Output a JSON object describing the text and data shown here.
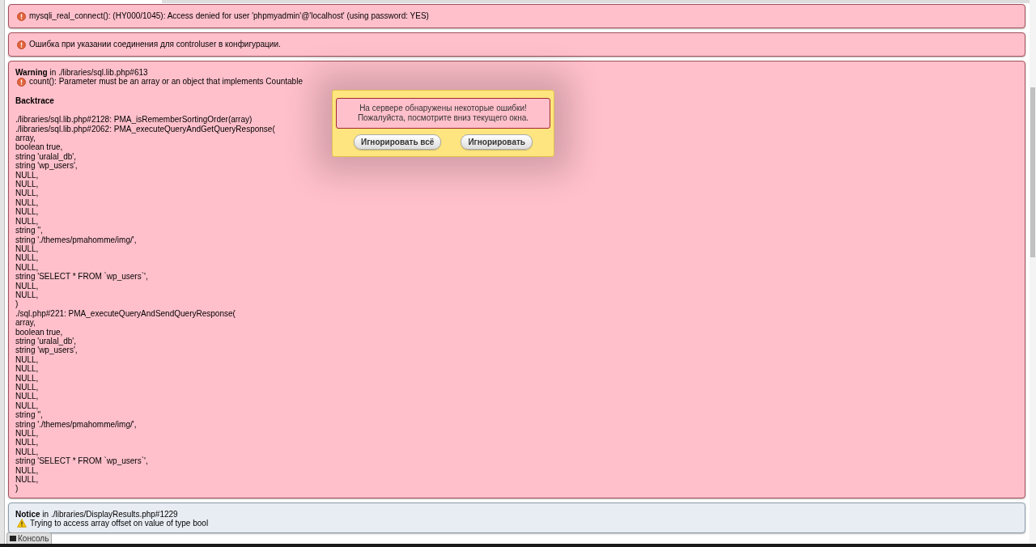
{
  "errors": [
    {
      "kind": "error",
      "message": "mysqli_real_connect(): (HY000/1045): Access denied for user 'phpmyadmin'@'localhost' (using password: YES)"
    },
    {
      "kind": "error",
      "message": "Ошибка при указании соединения для controluser в конфигурации."
    }
  ],
  "reports": [
    {
      "kind": "error",
      "heading": "Warning",
      "location": "in ./libraries/sql.lib.php#613",
      "message": "count(): Parameter must be an array or an object that implements Countable",
      "backtrace_title": "Backtrace",
      "backtrace": [
        "./libraries/sql.lib.php#2128: PMA_isRememberSortingOrder(array)",
        "./libraries/sql.lib.php#2062: PMA_executeQueryAndGetQueryResponse(",
        "array,",
        "boolean true,",
        "string 'uralal_db',",
        "string 'wp_users',",
        "NULL,",
        "NULL,",
        "NULL,",
        "NULL,",
        "NULL,",
        "NULL,",
        "string '',",
        "string './themes/pmahomme/img/',",
        "NULL,",
        "NULL,",
        "NULL,",
        "string 'SELECT * FROM `wp_users`',",
        "NULL,",
        "NULL,",
        ")",
        "./sql.php#221: PMA_executeQueryAndSendQueryResponse(",
        "array,",
        "boolean true,",
        "string 'uralal_db',",
        "string 'wp_users',",
        "NULL,",
        "NULL,",
        "NULL,",
        "NULL,",
        "NULL,",
        "NULL,",
        "string '',",
        "string './themes/pmahomme/img/',",
        "NULL,",
        "NULL,",
        "NULL,",
        "string 'SELECT * FROM `wp_users`',",
        "NULL,",
        "NULL,",
        ")"
      ]
    },
    {
      "kind": "warning",
      "heading": "Notice",
      "location": "in ./libraries/DisplayResults.php#1229",
      "message": "Trying to access array offset on value of type bool"
    }
  ],
  "dialog": {
    "message_lines": [
      "На сервере обнаружены некоторые ошибки!",
      "Пожалуйста, посмотрите вниз текущего окна."
    ],
    "buttons": [
      "Игнорировать всё",
      "Игнорировать"
    ]
  },
  "console_tab": {
    "label": "Консоль"
  }
}
